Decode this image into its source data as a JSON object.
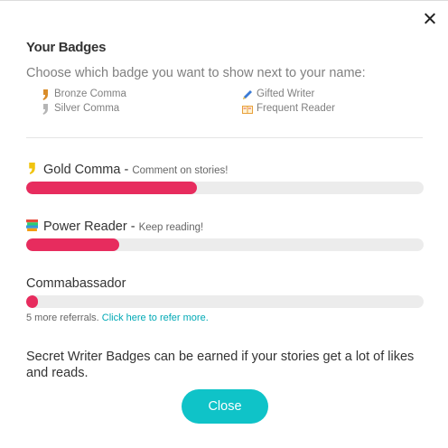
{
  "dialog": {
    "title": "Your Badges",
    "subtitle": "Choose which badge you want to show next to your name:"
  },
  "badge_options": [
    {
      "label": "Bronze Comma",
      "icon": "bronze-comma-icon"
    },
    {
      "label": "Gifted Writer",
      "icon": "pen-icon"
    },
    {
      "label": "Silver Comma",
      "icon": "silver-comma-icon"
    },
    {
      "label": "Frequent Reader",
      "icon": "book-icon"
    }
  ],
  "progress": [
    {
      "name": "Gold Comma",
      "separator": " - ",
      "hint": "Comment on stories!",
      "icon": "gold-comma-icon",
      "fraction": 0.43
    },
    {
      "name": "Power Reader",
      "separator": " - ",
      "hint": "Keep reading!",
      "icon": "books-icon",
      "fraction": 0.235
    },
    {
      "name": "Commabassador",
      "fraction": 0.03,
      "refer_text": "5 more referrals.",
      "refer_link": "Click here to refer more."
    }
  ],
  "secret_text": "Secret Writer Badges can be earned if your stories get a lot of likes and reads.",
  "close_label": "Close",
  "colors": {
    "accent": "#e72c5e",
    "button": "#0fc3c8",
    "link": "#00a9b5"
  }
}
